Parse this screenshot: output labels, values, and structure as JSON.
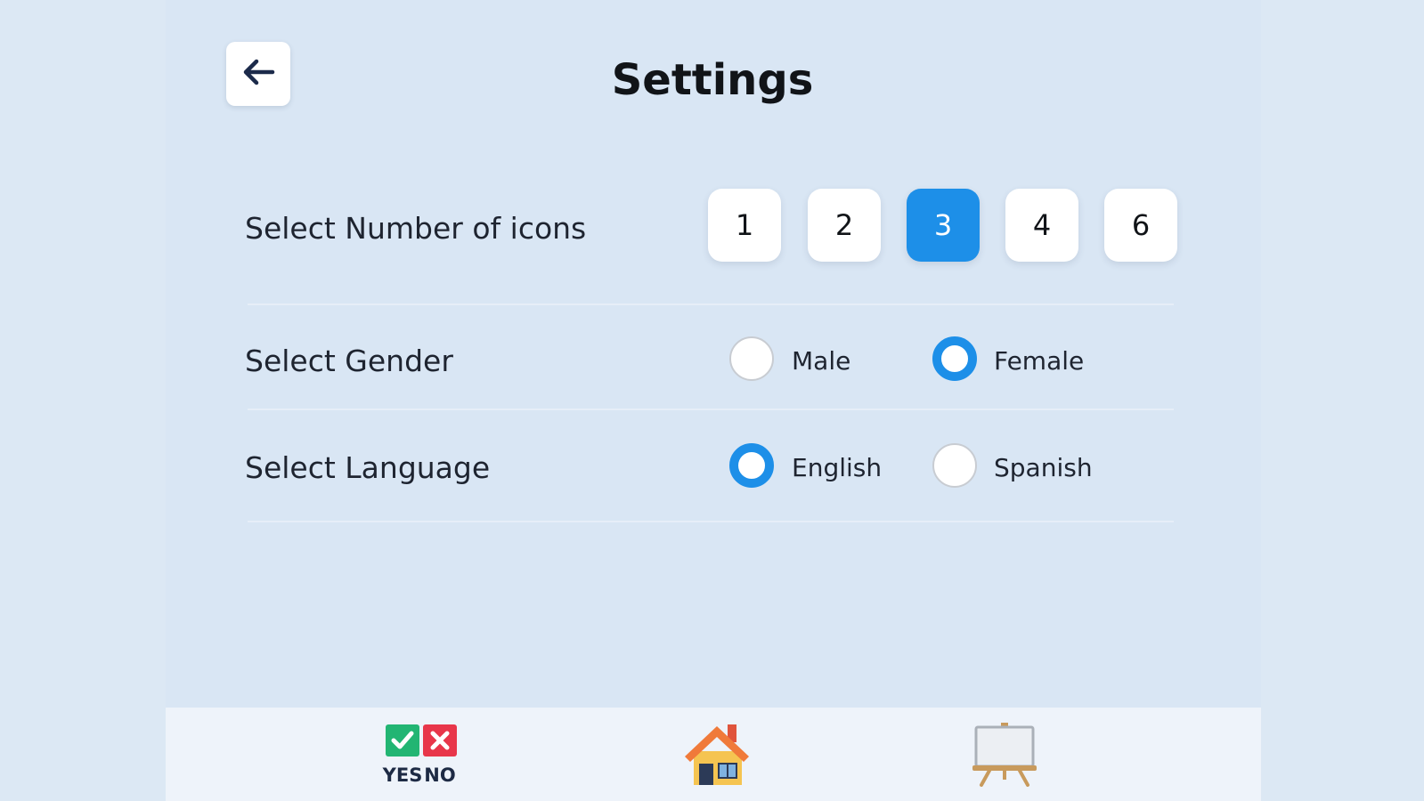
{
  "header": {
    "title": "Settings",
    "back_icon": "arrow-left-icon"
  },
  "settings": {
    "icons_row": {
      "label": "Select Number of icons",
      "options": [
        "1",
        "2",
        "3",
        "4",
        "6"
      ],
      "selected": "3"
    },
    "gender_row": {
      "label": "Select Gender",
      "options": [
        "Male",
        "Female"
      ],
      "selected": "Female"
    },
    "language_row": {
      "label": "Select Language",
      "options": [
        "English",
        "Spanish"
      ],
      "selected": "English"
    }
  },
  "bottom_nav": {
    "items": [
      {
        "icon": "yes-no-icon",
        "text_yes": "YES",
        "text_no": "NO"
      },
      {
        "icon": "house-icon"
      },
      {
        "icon": "easel-board-icon"
      }
    ]
  },
  "colors": {
    "accent": "#1d8fe8",
    "background": "#dce8f4",
    "card": "#ffffff",
    "text": "#1e2430"
  }
}
